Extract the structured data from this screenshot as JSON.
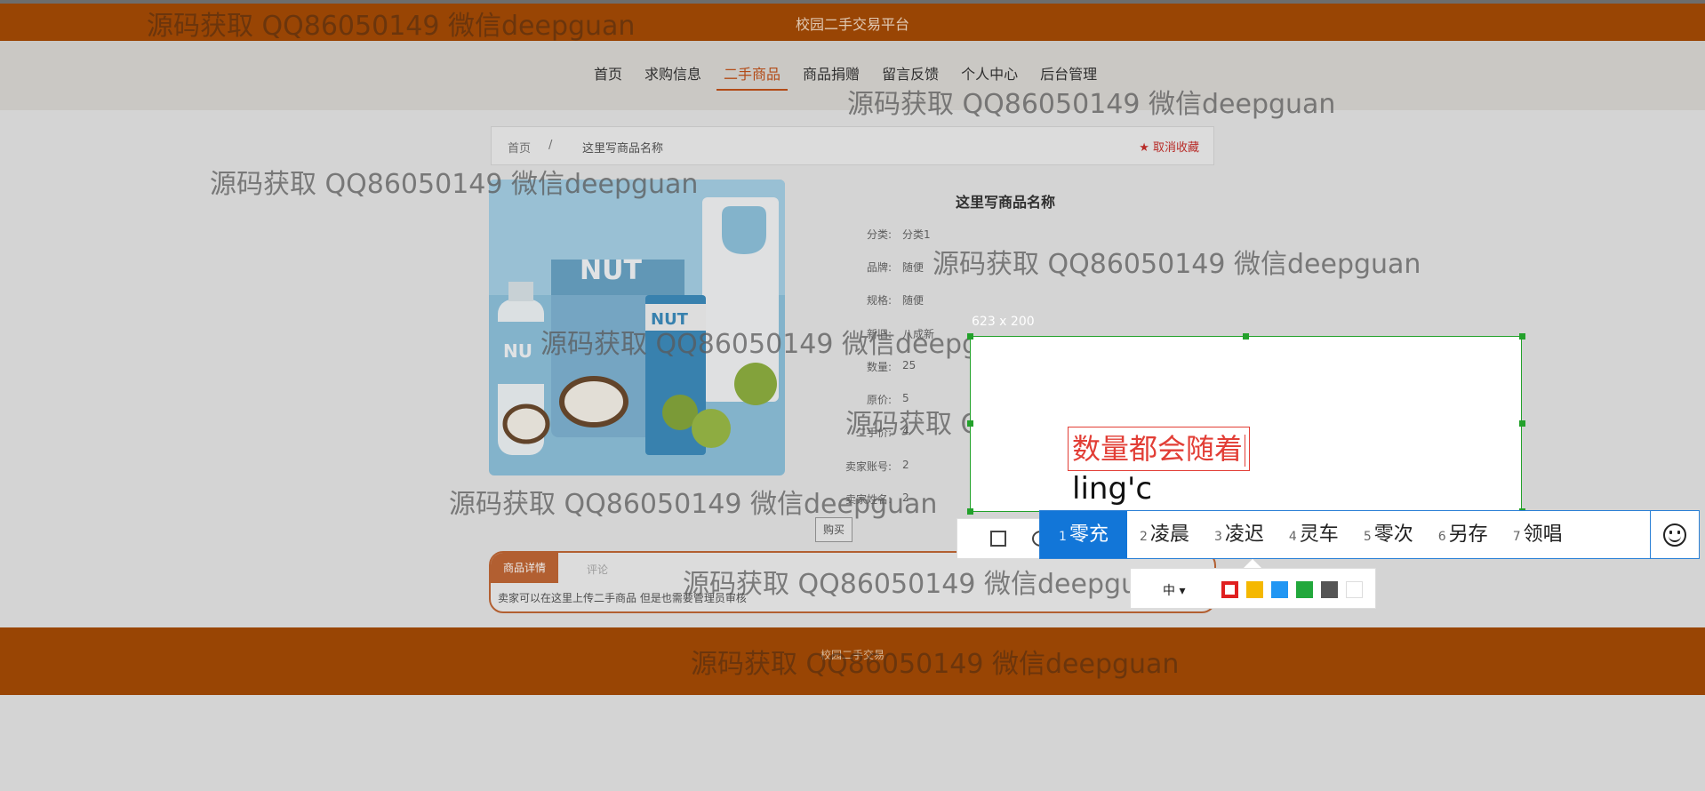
{
  "site": {
    "title": "校园二手交易平台"
  },
  "nav": [
    {
      "label": "首页"
    },
    {
      "label": "求购信息"
    },
    {
      "label": "二手商品",
      "active": true
    },
    {
      "label": "商品捐赠"
    },
    {
      "label": "留言反馈"
    },
    {
      "label": "个人中心"
    },
    {
      "label": "后台管理"
    }
  ],
  "breadcrumb": {
    "home": "首页",
    "sep": "/",
    "current": "这里写商品名称",
    "unfavorite": "★ 取消收藏"
  },
  "product": {
    "name": "这里写商品名称",
    "specs": [
      {
        "key": "分类:",
        "value": "分类1"
      },
      {
        "key": "品牌:",
        "value": "随便"
      },
      {
        "key": "规格:",
        "value": "随便"
      },
      {
        "key": "新旧:",
        "value": "八成新"
      },
      {
        "key": "数量:",
        "value": "25"
      },
      {
        "key": "原价:",
        "value": "5"
      },
      {
        "key": "二手价:",
        "value": "4"
      },
      {
        "key": "卖家账号:",
        "value": "2"
      },
      {
        "key": "卖家姓名:",
        "value": "2"
      }
    ],
    "buy_label": "购买"
  },
  "detail": {
    "tab_detail": "商品详情",
    "tab_comment": "评论",
    "text": "卖家可以在这里上传二手商品 但是也需要管理员审核"
  },
  "footer": {
    "text": "校园二手交易"
  },
  "watermark": "源码获取 QQ86050149 微信deepguan",
  "capture": {
    "size_label": "623 x 200",
    "text_red": "数量都会随着",
    "text_typing": "ling'c",
    "size_option": "中",
    "colors": [
      "#e02020",
      "#f5b800",
      "#2196f3",
      "#22a83c",
      "#555555",
      "#ffffff"
    ],
    "toolbar_icons": [
      "rectangle-icon",
      "ellipse-icon"
    ]
  },
  "ime": {
    "candidates": [
      {
        "num": "1",
        "text": "零充",
        "selected": true
      },
      {
        "num": "2",
        "text": "凌晨"
      },
      {
        "num": "3",
        "text": "凌迟"
      },
      {
        "num": "4",
        "text": "灵车"
      },
      {
        "num": "5",
        "text": "零次"
      },
      {
        "num": "6",
        "text": "另存"
      },
      {
        "num": "7",
        "text": "领唱"
      }
    ],
    "emoji_icon": "smile-icon"
  }
}
